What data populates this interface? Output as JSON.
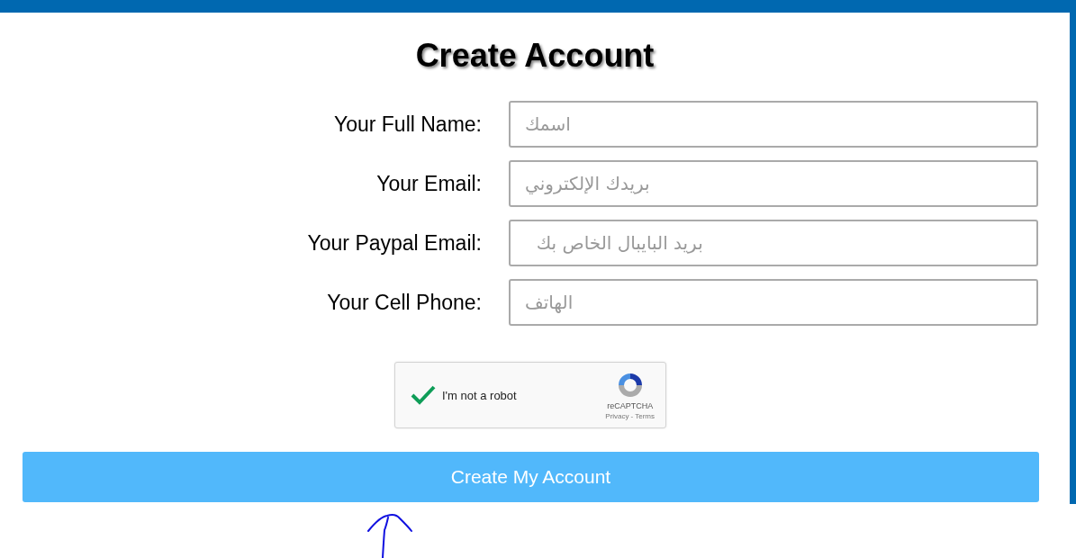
{
  "title": "Create Account",
  "fields": [
    {
      "label": "Your Full Name:",
      "placeholder": "اسمك"
    },
    {
      "label": "Your Email:",
      "placeholder": "بريدك الإلكتروني"
    },
    {
      "label": "Your Paypal Email:",
      "placeholder": "  بريد البايبال الخاص بك"
    },
    {
      "label": "Your Cell Phone:",
      "placeholder": "الهاتف"
    }
  ],
  "captcha": {
    "label": "I'm not a robot",
    "checked": true,
    "brand": "reCAPTCHA",
    "links": [
      "Privacy",
      "Terms"
    ],
    "separator": "-"
  },
  "submit": "Create My Account"
}
